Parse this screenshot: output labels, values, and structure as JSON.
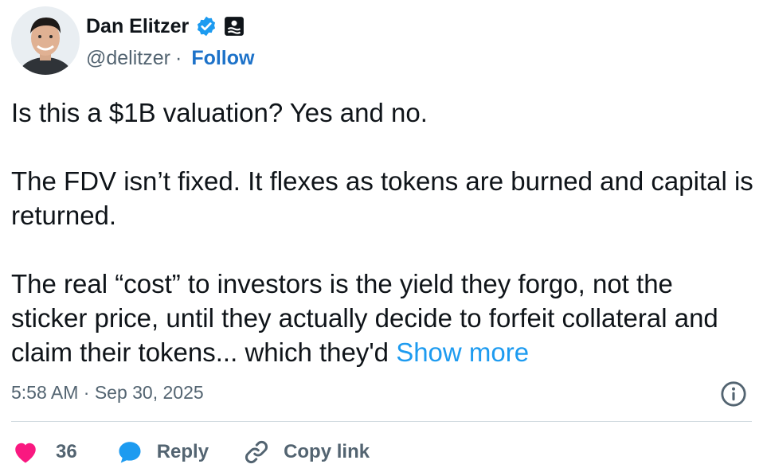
{
  "author": {
    "name": "Dan Elitzer",
    "handle": "@delitzer",
    "separator": "·",
    "follow_label": "Follow"
  },
  "tweet": {
    "paragraphs": [
      "Is this a $1B valuation? Yes and no.",
      "The FDV isn’t fixed. It flexes as tokens are burned and capital is returned.",
      "The real “cost” to investors is the yield they forgo, not the sticker price, until they actually decide to forfeit collateral and claim their tokens... which they'd"
    ],
    "show_more_label": "Show more",
    "timestamp": "5:58 AM · Sep 30, 2025"
  },
  "actions": {
    "likes_count": "36",
    "reply_label": "Reply",
    "copy_link_label": "Copy link"
  },
  "colors": {
    "like": "#f91880",
    "reply": "#1d9bf0",
    "link": "#1d9bf0",
    "follow": "#1d72c9",
    "muted": "#536471"
  },
  "icons": [
    "verified-badge-icon",
    "affiliate-badge-icon",
    "info-icon",
    "heart-icon",
    "reply-bubble-icon",
    "link-icon"
  ]
}
